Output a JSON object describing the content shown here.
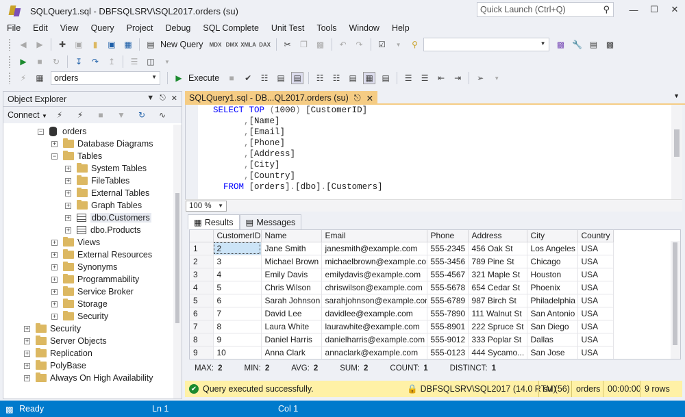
{
  "window": {
    "title": "SQLQuery1.sql - DBFSQLSRV\\SQL2017.orders (su)",
    "quick_launch_placeholder": "Quick Launch (Ctrl+Q)"
  },
  "menu": [
    "File",
    "Edit",
    "View",
    "Query",
    "Project",
    "Debug",
    "SQL Complete",
    "Unit Test",
    "Tools",
    "Window",
    "Help"
  ],
  "toolbar": {
    "new_query": "New Query",
    "execute": "Execute",
    "database": "orders",
    "icon_labels": [
      "MDX",
      "DMX",
      "XMLA",
      "DAX"
    ]
  },
  "object_explorer": {
    "title": "Object Explorer",
    "connect": "Connect",
    "tree": [
      {
        "label": "orders",
        "level": 2,
        "expander": "−",
        "icon": "db"
      },
      {
        "label": "Database Diagrams",
        "level": 3,
        "expander": "+",
        "icon": "folder"
      },
      {
        "label": "Tables",
        "level": 3,
        "expander": "−",
        "icon": "folder"
      },
      {
        "label": "System Tables",
        "level": 4,
        "expander": "+",
        "icon": "folder"
      },
      {
        "label": "FileTables",
        "level": 4,
        "expander": "+",
        "icon": "folder"
      },
      {
        "label": "External Tables",
        "level": 4,
        "expander": "+",
        "icon": "folder"
      },
      {
        "label": "Graph Tables",
        "level": 4,
        "expander": "+",
        "icon": "folder"
      },
      {
        "label": "dbo.Customers",
        "level": 4,
        "expander": "+",
        "icon": "table",
        "selected": true
      },
      {
        "label": "dbo.Products",
        "level": 4,
        "expander": "+",
        "icon": "table"
      },
      {
        "label": "Views",
        "level": 3,
        "expander": "+",
        "icon": "folder"
      },
      {
        "label": "External Resources",
        "level": 3,
        "expander": "+",
        "icon": "folder"
      },
      {
        "label": "Synonyms",
        "level": 3,
        "expander": "+",
        "icon": "folder"
      },
      {
        "label": "Programmability",
        "level": 3,
        "expander": "+",
        "icon": "folder"
      },
      {
        "label": "Service Broker",
        "level": 3,
        "expander": "+",
        "icon": "folder"
      },
      {
        "label": "Storage",
        "level": 3,
        "expander": "+",
        "icon": "folder"
      },
      {
        "label": "Security",
        "level": 3,
        "expander": "+",
        "icon": "folder"
      },
      {
        "label": "Security",
        "level": 1,
        "expander": "+",
        "icon": "folder"
      },
      {
        "label": "Server Objects",
        "level": 1,
        "expander": "+",
        "icon": "folder"
      },
      {
        "label": "Replication",
        "level": 1,
        "expander": "+",
        "icon": "folder"
      },
      {
        "label": "PolyBase",
        "level": 1,
        "expander": "+",
        "icon": "folder"
      },
      {
        "label": "Always On High Availability",
        "level": 1,
        "expander": "+",
        "icon": "folder"
      }
    ]
  },
  "editor": {
    "tab_title": "SQLQuery1.sql - DB...QL2017.orders (su)",
    "zoom": "100 %",
    "lines": [
      {
        "indent": "",
        "parts": [
          [
            "kw",
            "SELECT"
          ],
          [
            "",
            " "
          ],
          [
            "kw",
            "TOP"
          ],
          [
            "",
            " "
          ],
          [
            "gr",
            "("
          ],
          [
            "",
            "1000"
          ],
          [
            "gr",
            ")"
          ],
          [
            "",
            " [CustomerID]"
          ]
        ]
      },
      {
        "indent": "      ",
        "parts": [
          [
            "gr",
            ","
          ],
          [
            "",
            "[Name]"
          ]
        ]
      },
      {
        "indent": "      ",
        "parts": [
          [
            "gr",
            ","
          ],
          [
            "",
            "[Email]"
          ]
        ]
      },
      {
        "indent": "      ",
        "parts": [
          [
            "gr",
            ","
          ],
          [
            "",
            "[Phone]"
          ]
        ]
      },
      {
        "indent": "      ",
        "parts": [
          [
            "gr",
            ","
          ],
          [
            "",
            "[Address]"
          ]
        ]
      },
      {
        "indent": "      ",
        "parts": [
          [
            "gr",
            ","
          ],
          [
            "",
            "[City]"
          ]
        ]
      },
      {
        "indent": "      ",
        "parts": [
          [
            "gr",
            ","
          ],
          [
            "",
            "[Country]"
          ]
        ]
      },
      {
        "indent": "  ",
        "parts": [
          [
            "kw",
            "FROM"
          ],
          [
            "",
            " [orders]"
          ],
          [
            "gr",
            "."
          ],
          [
            "",
            "[dbo]"
          ],
          [
            "gr",
            "."
          ],
          [
            "",
            "[Customers]"
          ]
        ]
      }
    ]
  },
  "results": {
    "tabs": [
      "Results",
      "Messages"
    ],
    "columns": [
      "CustomerID",
      "Name",
      "Email",
      "Phone",
      "Address",
      "City",
      "Country"
    ],
    "rows": [
      [
        "1",
        "2",
        "Jane Smith",
        "janesmith@example.com",
        "555-2345",
        "456 Oak St",
        "Los Angeles",
        "USA"
      ],
      [
        "2",
        "3",
        "Michael Brown",
        "michaelbrown@example.com",
        "555-3456",
        "789 Pine St",
        "Chicago",
        "USA"
      ],
      [
        "3",
        "4",
        "Emily Davis",
        "emilydavis@example.com",
        "555-4567",
        "321 Maple St",
        "Houston",
        "USA"
      ],
      [
        "4",
        "5",
        "Chris Wilson",
        "chriswilson@example.com",
        "555-5678",
        "654 Cedar St",
        "Phoenix",
        "USA"
      ],
      [
        "5",
        "6",
        "Sarah Johnson",
        "sarahjohnson@example.com",
        "555-6789",
        "987 Birch St",
        "Philadelphia",
        "USA"
      ],
      [
        "6",
        "7",
        "David Lee",
        "davidlee@example.com",
        "555-7890",
        "111 Walnut St",
        "San Antonio",
        "USA"
      ],
      [
        "7",
        "8",
        "Laura White",
        "laurawhite@example.com",
        "555-8901",
        "222 Spruce St",
        "San Diego",
        "USA"
      ],
      [
        "8",
        "9",
        "Daniel Harris",
        "danielharris@example.com",
        "555-9012",
        "333 Poplar St",
        "Dallas",
        "USA"
      ],
      [
        "9",
        "10",
        "Anna Clark",
        "annaclark@example.com",
        "555-0123",
        "444 Sycamo...",
        "San Jose",
        "USA"
      ]
    ],
    "aggregates": [
      {
        "label": "MAX:",
        "value": "2"
      },
      {
        "label": "MIN:",
        "value": "2"
      },
      {
        "label": "AVG:",
        "value": "2"
      },
      {
        "label": "SUM:",
        "value": "2"
      },
      {
        "label": "COUNT:",
        "value": "1"
      },
      {
        "label": "DISTINCT:",
        "value": "1"
      }
    ]
  },
  "query_status": {
    "message": "Query executed successfully.",
    "server": "DBFSQLSRV\\SQL2017 (14.0 RTM)",
    "user": "su (56)",
    "database": "orders",
    "time": "00:00:00",
    "rows": "9 rows"
  },
  "statusbar": {
    "state": "Ready",
    "line": "Ln 1",
    "col": "Col 1"
  },
  "colors": {
    "accent": "#007acc",
    "tab": "#f5cc84",
    "status": "#fff1a6"
  }
}
